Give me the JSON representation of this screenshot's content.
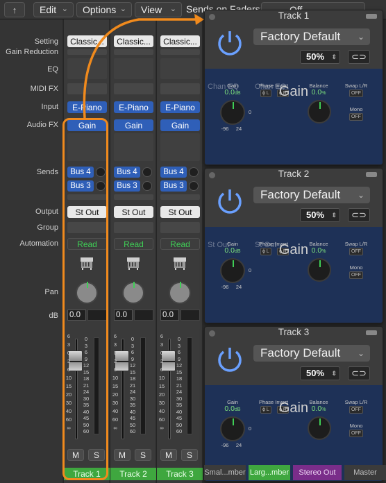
{
  "topbar": {
    "menus": [
      {
        "label": "Edit"
      },
      {
        "label": "Options"
      },
      {
        "label": "View"
      }
    ],
    "sends_label": "Sends on Faders:",
    "sends_value": "Off",
    "back_icon": "back-arrow-icon"
  },
  "rows": {
    "setting": "Setting",
    "gain_reduction": "Gain Reduction",
    "eq": "EQ",
    "midi_fx": "MIDI FX",
    "input": "Input",
    "audio_fx": "Audio FX",
    "sends": "Sends",
    "output": "Output",
    "group": "Group",
    "automation": "Automation",
    "pan": "Pan",
    "db": "dB"
  },
  "strips": [
    {
      "setting": "Classic...",
      "input": "E-Piano",
      "audio_fx": "Gain",
      "send1": "Bus 4",
      "send2": "Bus 3",
      "output": "St Out",
      "automation": "Read",
      "db": "0.0",
      "mute": "M",
      "solo": "S",
      "name": "Track 1"
    },
    {
      "setting": "Classic...",
      "input": "E-Piano",
      "audio_fx": "Gain",
      "send1": "Bus 4",
      "send2": "Bus 3",
      "output": "St Out",
      "automation": "Read",
      "db": "0.0",
      "mute": "M",
      "solo": "S",
      "name": "Track 2"
    },
    {
      "setting": "Classic...",
      "input": "E-Piano",
      "audio_fx": "Gain",
      "send1": "Bus 4",
      "send2": "Bus 3",
      "output": "St Out",
      "automation": "Read",
      "db": "0.0",
      "mute": "M",
      "solo": "S",
      "name": "Track 3"
    }
  ],
  "fader_scale": [
    "6",
    "3",
    "0",
    "3",
    "6",
    "10",
    "15",
    "20",
    "30",
    "40",
    "60",
    "∞"
  ],
  "meter_scale": [
    "0",
    "3",
    "6",
    "9",
    "12",
    "15",
    "18",
    "21",
    "24",
    "30",
    "35",
    "40",
    "45",
    "50",
    "60"
  ],
  "plugins": [
    {
      "title": "Track 1",
      "preset": "Factory Default",
      "mix": "50%",
      "gain_label": "Gain",
      "gain_value": "0.0",
      "gain_unit": "dB",
      "range_min": "-96",
      "range_max": "24",
      "knob_zero": "0",
      "phase_label": "Phase Invert",
      "phase_l": "ϕ L",
      "phase_r": "ϕ R",
      "balance_label": "Balance",
      "balance_value": "0.0",
      "balance_unit": "%",
      "swap_label": "Swap L/R",
      "swap_value": "OFF",
      "mono_label": "Mono",
      "mono_value": "OFF",
      "plugin_name": "Gain",
      "ghost1": "Chan EQ",
      "ghost2": "Chan EQ"
    },
    {
      "title": "Track 2",
      "preset": "Factory Default",
      "mix": "50%",
      "gain_label": "Gain",
      "gain_value": "0.0",
      "gain_unit": "dB",
      "range_min": "-96",
      "range_max": "24",
      "knob_zero": "0",
      "phase_label": "Phase Invert",
      "phase_l": "ϕ L",
      "phase_r": "ϕ R",
      "balance_label": "Balance",
      "balance_value": "0.0",
      "balance_unit": "%",
      "swap_label": "Swap L/R",
      "swap_value": "OFF",
      "mono_label": "Mono",
      "mono_value": "OFF",
      "plugin_name": "Gain",
      "ghost1": "St Out",
      "ghost2": "St Out"
    },
    {
      "title": "Track 3",
      "preset": "Factory Default",
      "mix": "50%",
      "gain_label": "Gain",
      "gain_value": "0.0",
      "gain_unit": "dB",
      "range_min": "-96",
      "range_max": "24",
      "knob_zero": "0",
      "phase_label": "Phase Invert",
      "phase_l": "ϕ L",
      "phase_r": "ϕ R",
      "balance_label": "Balance",
      "balance_value": "0.0",
      "balance_unit": "%",
      "swap_label": "Swap L/R",
      "swap_value": "OFF",
      "mono_label": "Mono",
      "mono_value": "OFF",
      "plugin_name": "Gain",
      "ghost1": "",
      "ghost2": ""
    }
  ],
  "bottom": {
    "small": "Smal...mber",
    "large": "Larg...mber",
    "stereo_out": "Stereo Out",
    "master": "Master"
  },
  "colors": {
    "accent_orange": "#f08a1d",
    "track_green": "#3fa73f",
    "send_blue": "#2f5fb8",
    "read_green": "#3fcf56",
    "power_blue": "#6aa0ff"
  }
}
